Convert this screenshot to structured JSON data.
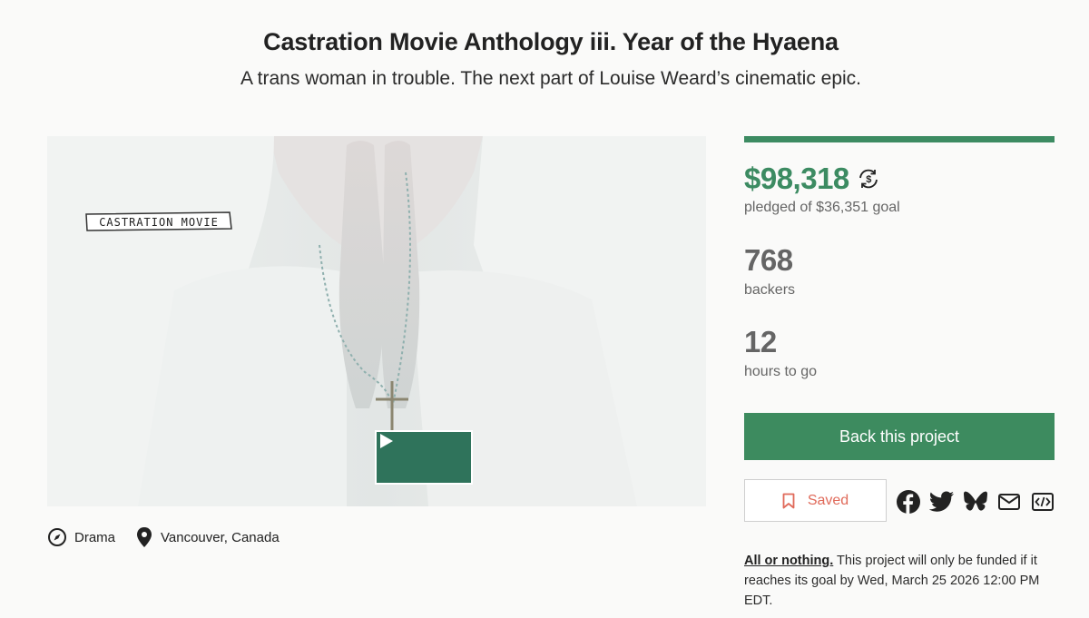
{
  "project": {
    "title": "Castration Movie Anthology iii. Year of the Hyaena",
    "blurb": "A trans woman in trouble. The next part of Louise Weard’s cinematic epic."
  },
  "video": {
    "label": "CASTRATION MOVIE",
    "play_icon": "play-icon"
  },
  "meta": {
    "category": "Drama",
    "location": "Vancouver, Canada"
  },
  "stats": {
    "funded_fraction": 1.0,
    "pledged": "$98,318",
    "pledged_label": "pledged of $36,351 goal",
    "backers": "768",
    "backers_label": "backers",
    "time_left": "12",
    "time_left_label": "hours to go"
  },
  "actions": {
    "back_label": "Back this project",
    "saved_label": "Saved"
  },
  "share": [
    "facebook-icon",
    "twitter-icon",
    "bluesky-icon",
    "email-icon",
    "embed-icon"
  ],
  "funding_note": {
    "link": "All or nothing.",
    "text": " This project will only be funded if it reaches its goal by Wed, March 25 2026 12:00 PM EDT."
  },
  "colors": {
    "accent": "#3c8b62",
    "saved": "#e06a5a"
  }
}
